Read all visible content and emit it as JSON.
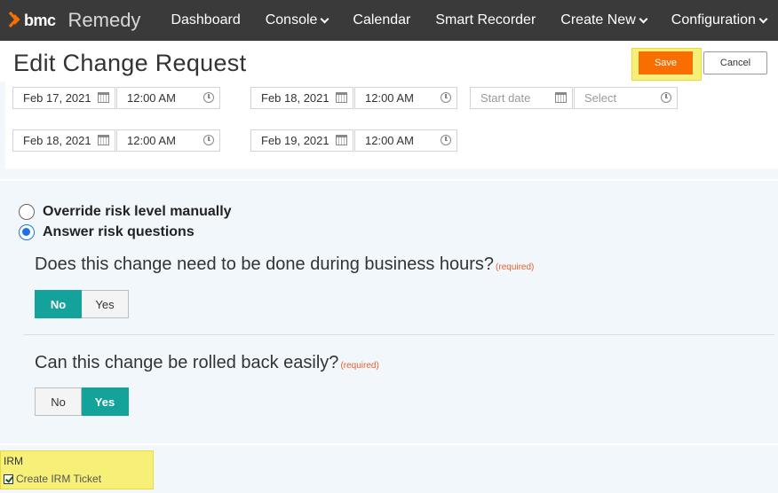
{
  "brand": {
    "logo_text": "bmc",
    "product": "Remedy",
    "accent": "#f86e00"
  },
  "nav": {
    "items": [
      {
        "label": "Dashboard",
        "has_dropdown": false
      },
      {
        "label": "Console",
        "has_dropdown": true
      },
      {
        "label": "Calendar",
        "has_dropdown": false
      },
      {
        "label": "Smart Recorder",
        "has_dropdown": false
      },
      {
        "label": "Create New",
        "has_dropdown": true
      },
      {
        "label": "Configuration",
        "has_dropdown": true
      }
    ]
  },
  "header": {
    "title": "Edit Change Request",
    "save_label": "Save",
    "cancel_label": "Cancel"
  },
  "dates": {
    "row1": [
      {
        "date": "Feb 17, 2021",
        "time": "12:00 AM"
      },
      {
        "date": "Feb 18, 2021",
        "time": "12:00 AM"
      },
      {
        "date_placeholder": "Start date",
        "time_placeholder": "Select"
      }
    ],
    "row2": [
      {
        "date": "Feb 18, 2021",
        "time": "12:00 AM"
      },
      {
        "date": "Feb 19, 2021",
        "time": "12:00 AM"
      }
    ]
  },
  "risk": {
    "options": [
      {
        "label": "Override risk level manually",
        "checked": false
      },
      {
        "label": "Answer risk questions",
        "checked": true
      }
    ],
    "questions": [
      {
        "text": "Does this change need to be done during business hours?",
        "required_label": "(required)",
        "options": [
          "No",
          "Yes"
        ],
        "selected": "No"
      },
      {
        "text": "Can this change be rolled back easily?",
        "required_label": "(required)",
        "options": [
          "No",
          "Yes"
        ],
        "selected": "Yes"
      }
    ]
  },
  "irm": {
    "section_label": "IRM",
    "checkbox_label": "Create IRM Ticket",
    "checked": true
  },
  "colors": {
    "toggle_active": "#14a39a",
    "highlight": "#f7f078",
    "nav_bg": "#3a3a3a"
  }
}
